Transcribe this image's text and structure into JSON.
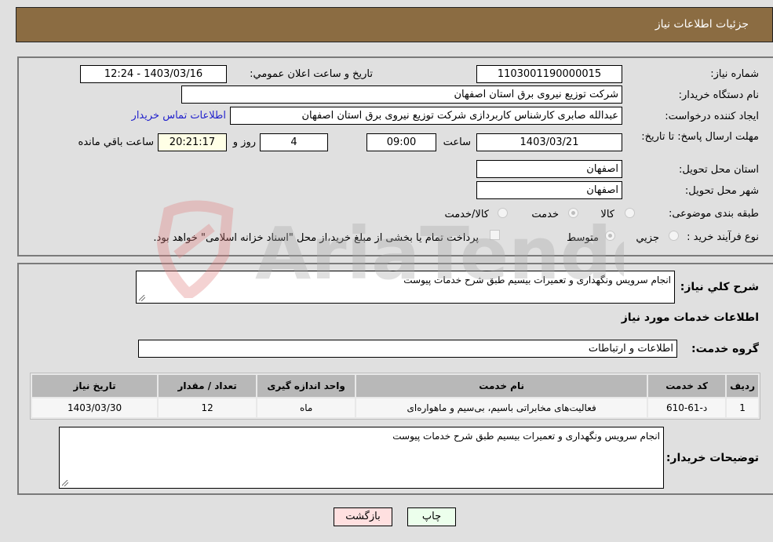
{
  "header": {
    "title": "جزئيات اطلاعات نياز"
  },
  "form": {
    "need_number": {
      "label": "شماره نياز:",
      "value": "1103001190000015"
    },
    "announce_datetime": {
      "label": "تاريخ و ساعت اعلان عمومي:",
      "value": "1403/03/16 - 12:24"
    },
    "buyer_org": {
      "label": "نام دستگاه خريدار:",
      "value": "شرکت توزیع نیروی برق استان اصفهان"
    },
    "requester": {
      "label": "ايجاد کننده درخواست:",
      "value": "عبدالله صابری کارشناس کاربردازی شرکت توزیع نیروی برق استان اصفهان"
    },
    "buyer_contact_link": "اطلاعات تماس خريدار",
    "deadline": {
      "label": "مهلت ارسال پاسخ: تا تاريخ:",
      "date": "1403/03/21",
      "time_label": "ساعت",
      "time": "09:00",
      "days": "4",
      "days_label": "روز و",
      "remaining": "20:21:17",
      "remaining_label": "ساعت باقي مانده"
    },
    "delivery_province": {
      "label": "استان محل تحويل:",
      "value": "اصفهان"
    },
    "delivery_city": {
      "label": "شهر محل تحويل:",
      "value": "اصفهان"
    },
    "category": {
      "label": "طبقه بندی موضوعی:",
      "options": [
        {
          "label": "کالا",
          "checked": false
        },
        {
          "label": "خدمت",
          "checked": true
        },
        {
          "label": "کالا/خدمت",
          "checked": false
        }
      ]
    },
    "purchase_type": {
      "label": "نوع فرآيند خريد :",
      "options": [
        {
          "label": "جزيي",
          "checked": false
        },
        {
          "label": "متوسط",
          "checked": true
        }
      ],
      "treasury_checkbox_label": "پرداخت تمام يا بخشی از مبلغ خريد،از محل \"اسناد خزانه اسلامی\" خواهد بود.",
      "treasury_checked": false
    }
  },
  "details": {
    "general_desc_label": "شرح کلي نياز:",
    "general_desc_value": "انجام سرويس ونگهداری  و تعميرات بيسيم طبق شرح خدمات پيوست",
    "services_heading": "اطلاعات خدمات مورد نياز",
    "service_group_label": "گروه خدمت:",
    "service_group_value": "اطلاعات و ارتباطات",
    "table": {
      "headers": [
        "رديف",
        "کد خدمت",
        "نام خدمت",
        "واحد اندازه گيری",
        "تعداد / مقدار",
        "تاريخ نياز"
      ],
      "rows": [
        [
          "1",
          "د-61-610",
          "فعاليت‌های مخابراتی باسيم، بی‌سيم و ماهواره‌ای",
          "ماه",
          "12",
          "1403/03/30"
        ]
      ]
    },
    "buyer_notes_label": "توضيحات خريدار:",
    "buyer_notes_value": "انجام سرويس ونگهداری  و تعميرات بيسيم طبق شرح خدمات پيوست"
  },
  "buttons": {
    "print": "چاپ",
    "back": "بازگشت"
  },
  "watermark": {
    "text": "AriaTender.neT"
  },
  "colors": {
    "header_bg": "#8b6c42",
    "link": "#2222cc",
    "print_bg": "#ecffec",
    "back_bg": "#ffe0e0"
  }
}
